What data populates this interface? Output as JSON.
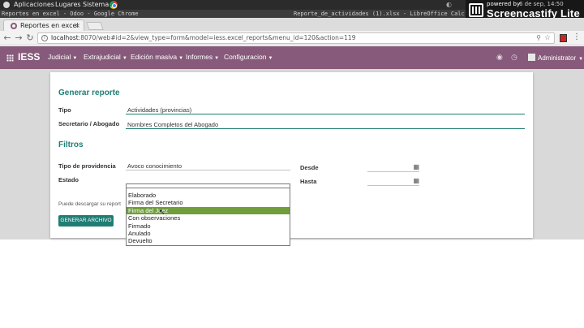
{
  "os_panel": {
    "menus": [
      "Aplicaciones",
      "Lugares",
      "Sistema"
    ],
    "clock": "6 de sep, 14:50"
  },
  "screencastify": {
    "powered_by": "powered by",
    "name": "Screencastify Lite"
  },
  "window_titles": {
    "left": "Reportes en excel - Odoo - Google Chrome",
    "right": "Reporte_de_actividades (1).xlsx - LibreOffice Calc"
  },
  "browser": {
    "tab_title": "Reportes en excel",
    "tab_close": "×",
    "url_host": "localhost",
    "url_rest": ":8070/web#id=2&view_type=form&model=iess.excel_reports&menu_id=120&action=119",
    "info_icon": "i"
  },
  "navbar": {
    "brand": "IESS",
    "menus": [
      "Judicial",
      "Extrajudicial",
      "Edición masiva",
      "Informes",
      "Configuracion"
    ],
    "user": "Administrator"
  },
  "form": {
    "section_generar": "Generar reporte",
    "tipo_label": "Tipo",
    "tipo_value": "Actividades (provincias)",
    "secretario_label": "Secretario / Abogado",
    "secretario_value": "Nombres Completos del Abogado",
    "section_filtros": "Filtros",
    "tipo_providencia_label": "Tipo de providencia",
    "tipo_providencia_value": "Avoco conocimiento",
    "estado_label": "Estado",
    "desde_label": "Desde",
    "hasta_label": "Hasta",
    "download_note": "Puede descargar su report",
    "generate_button": "GENERAR ARCHIVO"
  },
  "estado_dropdown": {
    "options": [
      "Elaborado",
      "Firma del Secretario",
      "Firma del Juez",
      "Con observaciones",
      "Firmado",
      "Anulado",
      "Devuelto"
    ],
    "selected_index": 2
  },
  "colors": {
    "odoo_purple": "#875a7b",
    "section_teal": "#1f7d74",
    "highlight_green": "#6f9e3b"
  }
}
